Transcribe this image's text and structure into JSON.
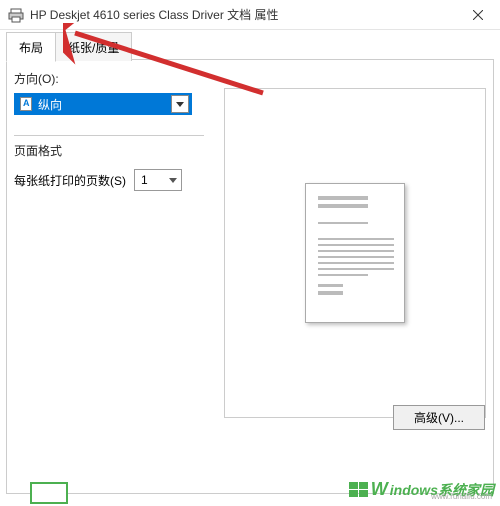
{
  "window": {
    "title": "HP Deskjet 4610 series Class Driver 文档 属性"
  },
  "tabs": {
    "layout": "布局",
    "paper_quality": "纸张/质量"
  },
  "orientation": {
    "label": "方向(O):",
    "selected": "纵向"
  },
  "page_format": {
    "title": "页面格式",
    "pages_per_sheet_label": "每张纸打印的页数(S)",
    "pages_per_sheet_value": "1"
  },
  "buttons": {
    "advanced": "高级(V)..."
  },
  "watermark": {
    "brand": "indows系统家园",
    "url": "www.ruhaifu.com"
  },
  "colors": {
    "accent": "#0078d7",
    "arrow": "#d22f2f",
    "brand_green": "#4cb050"
  }
}
